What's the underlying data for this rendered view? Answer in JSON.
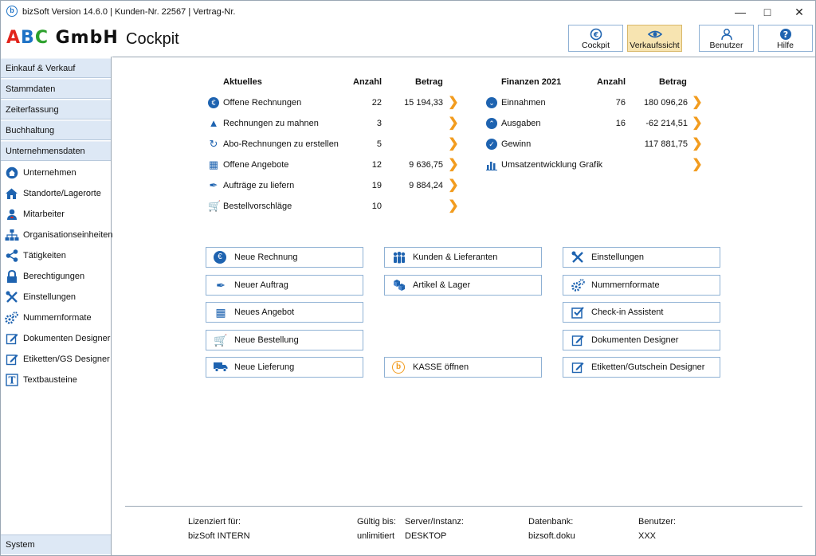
{
  "window": {
    "title": "bizSoft Version 14.6.0 | Kunden-Nr. 22567 | Vertrag-Nr."
  },
  "header": {
    "logo": "ABC GmbH",
    "page_title": "Cockpit",
    "buttons": [
      {
        "label": "Cockpit",
        "icon": "euro-circle-icon"
      },
      {
        "label": "Verkaufssicht",
        "icon": "eye-icon"
      },
      {
        "label": "Benutzer",
        "icon": "user-icon"
      },
      {
        "label": "Hilfe",
        "icon": "help-icon"
      }
    ]
  },
  "sidebar": {
    "categories": [
      "Einkauf & Verkauf",
      "Stammdaten",
      "Zeiterfassung",
      "Buchhaltung",
      "Unternehmensdaten"
    ],
    "items": [
      {
        "label": "Unternehmen",
        "icon": "home-circle-icon"
      },
      {
        "label": "Standorte/Lagerorte",
        "icon": "house-icon"
      },
      {
        "label": "Mitarbeiter",
        "icon": "employee-icon"
      },
      {
        "label": "Organisationseinheiten",
        "icon": "org-chart-icon"
      },
      {
        "label": "Tätigkeiten",
        "icon": "share-nodes-icon"
      },
      {
        "label": "Berechtigungen",
        "icon": "lock-icon"
      },
      {
        "label": "Einstellungen",
        "icon": "tools-icon"
      },
      {
        "label": "Nummernformate",
        "icon": "gears-icon"
      },
      {
        "label": "Dokumenten Designer",
        "icon": "edit-document-icon"
      },
      {
        "label": "Etiketten/GS Designer",
        "icon": "edit-label-icon"
      },
      {
        "label": "Textbausteine",
        "icon": "text-block-icon"
      }
    ],
    "bottom": "System"
  },
  "aktuelles": {
    "heading": "Aktuelles",
    "col_anzahl": "Anzahl",
    "col_betrag": "Betrag",
    "rows": [
      {
        "label": "Offene Rechnungen",
        "anzahl": "22",
        "betrag": "15 194,33",
        "icon": "euro-icon"
      },
      {
        "label": "Rechnungen zu mahnen",
        "anzahl": "3",
        "betrag": "",
        "icon": "warning-icon"
      },
      {
        "label": "Abo-Rechnungen zu erstellen",
        "anzahl": "5",
        "betrag": "",
        "icon": "recurring-icon"
      },
      {
        "label": "Offene Angebote",
        "anzahl": "12",
        "betrag": "9 636,75",
        "icon": "calculator-icon"
      },
      {
        "label": "Aufträge zu liefern",
        "anzahl": "19",
        "betrag": "9 884,24",
        "icon": "signature-icon"
      },
      {
        "label": "Bestellvorschläge",
        "anzahl": "10",
        "betrag": "",
        "icon": "cart-icon"
      }
    ]
  },
  "finanzen": {
    "heading": "Finanzen 2021",
    "col_anzahl": "Anzahl",
    "col_betrag": "Betrag",
    "rows": [
      {
        "label": "Einnahmen",
        "anzahl": "76",
        "betrag": "180 096,26",
        "icon": "chevron-down-circle-icon"
      },
      {
        "label": "Ausgaben",
        "anzahl": "16",
        "betrag": "-62 214,51",
        "icon": "chevron-up-circle-icon"
      },
      {
        "label": "Gewinn",
        "anzahl": "",
        "betrag": "117 881,75",
        "icon": "check-circle-icon"
      },
      {
        "label": "Umsatzentwicklung Grafik",
        "anzahl": "",
        "betrag": "",
        "icon": "bar-chart-icon"
      }
    ]
  },
  "actions": {
    "col1": [
      {
        "label": "Neue Rechnung",
        "icon": "euro-icon"
      },
      {
        "label": "Neuer Auftrag",
        "icon": "signature-icon"
      },
      {
        "label": "Neues Angebot",
        "icon": "calculator-icon"
      },
      {
        "label": "Neue Bestellung",
        "icon": "cart-icon"
      },
      {
        "label": "Neue Lieferung",
        "icon": "truck-icon"
      }
    ],
    "col2": [
      {
        "label": "Kunden & Lieferanten",
        "icon": "people-icon"
      },
      {
        "label": "Artikel & Lager",
        "icon": "boxes-icon"
      },
      {
        "label": "KASSE öffnen",
        "icon": "bizsoft-logo-icon"
      }
    ],
    "col3": [
      {
        "label": "Einstellungen",
        "icon": "tools-icon"
      },
      {
        "label": "Nummernformate",
        "icon": "gears-icon"
      },
      {
        "label": "Check-in Assistent",
        "icon": "checkbox-icon"
      },
      {
        "label": "Dokumenten Designer",
        "icon": "edit-document-icon"
      },
      {
        "label": "Etiketten/Gutschein Designer",
        "icon": "edit-label-icon"
      }
    ]
  },
  "footer": {
    "lizenziert_label": "Lizenziert für:",
    "lizenziert_value": "bizSoft INTERN",
    "gueltig_label": "Gültig bis:",
    "gueltig_value": "unlimitiert",
    "server_label": "Server/Instanz:",
    "server_value": "DESKTOP",
    "datenbank_label": "Datenbank:",
    "datenbank_value": "bizsoft.doku",
    "benutzer_label": "Benutzer:",
    "benutzer_value": "XXX"
  },
  "colors": {
    "accent": "#1e63b0",
    "arrow": "#f29c1f",
    "sidebar_cat": "#dde8f5",
    "active_tab": "#f7e4b1"
  }
}
